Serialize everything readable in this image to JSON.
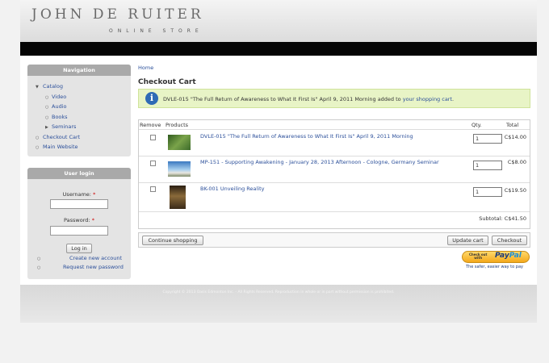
{
  "header": {
    "logo_title": "JOHN DE RUITER",
    "logo_subtitle": "ONLINE STORE"
  },
  "navigation": {
    "title": "Navigation",
    "catalog": "Catalog",
    "video": "Video",
    "audio": "Audio",
    "books": "Books",
    "seminars": "Seminars",
    "checkout_cart": "Checkout Cart",
    "main_website": "Main Website"
  },
  "login": {
    "title": "User login",
    "username_label": "Username:",
    "password_label": "Password:",
    "required_mark": "*",
    "login_button": "Log in",
    "create_account": "Create new account",
    "request_password": "Request new password"
  },
  "breadcrumb": "Home",
  "page_title": "Checkout Cart",
  "message": {
    "icon": "i",
    "text": "DVLE-015 \"The Full Return of Awareness to What It First Is\" April 9, 2011 Morning added to ",
    "link": "your shopping cart",
    "end": "."
  },
  "cart": {
    "headers": {
      "remove": "Remove",
      "products": "Products",
      "qty": "Qty.",
      "total": "Total"
    },
    "rows": [
      {
        "name": "DVLE-015 \"The Full Return of Awareness to What It First Is\" April 9, 2011 Morning",
        "qty": "1",
        "price": "C$14.00",
        "thumb": "video-thumbnail"
      },
      {
        "name": "MP-151 - Supporting Awakening - January 28, 2013 Afternoon - Cologne, Germany Seminar",
        "qty": "1",
        "price": "C$8.00",
        "thumb": "audio-thumbnail"
      },
      {
        "name": "BK-001 Unveiling Reality",
        "qty": "1",
        "price": "C$19.50",
        "thumb": "book-thumbnail"
      }
    ],
    "subtotal": "Subtotal: C$41.50"
  },
  "actions": {
    "continue": "Continue shopping",
    "update": "Update cart",
    "checkout": "Checkout"
  },
  "paypal": {
    "small_line1": "Check out",
    "small_line2": "with",
    "logo_pay": "Pay",
    "logo_pal": "Pal",
    "tagline": "The safer, easier way to pay"
  },
  "footer": {
    "text": "Copyright © 2013 Oasis Edmonton Inc. - All Rights Reserved. Reproduction in whole or in part without permission is prohibited."
  },
  "colors": {
    "link": "#2b4f9a",
    "message_bg": "#e8f4c6",
    "topbar": "#050505",
    "block_title": "#a9a9a9"
  }
}
